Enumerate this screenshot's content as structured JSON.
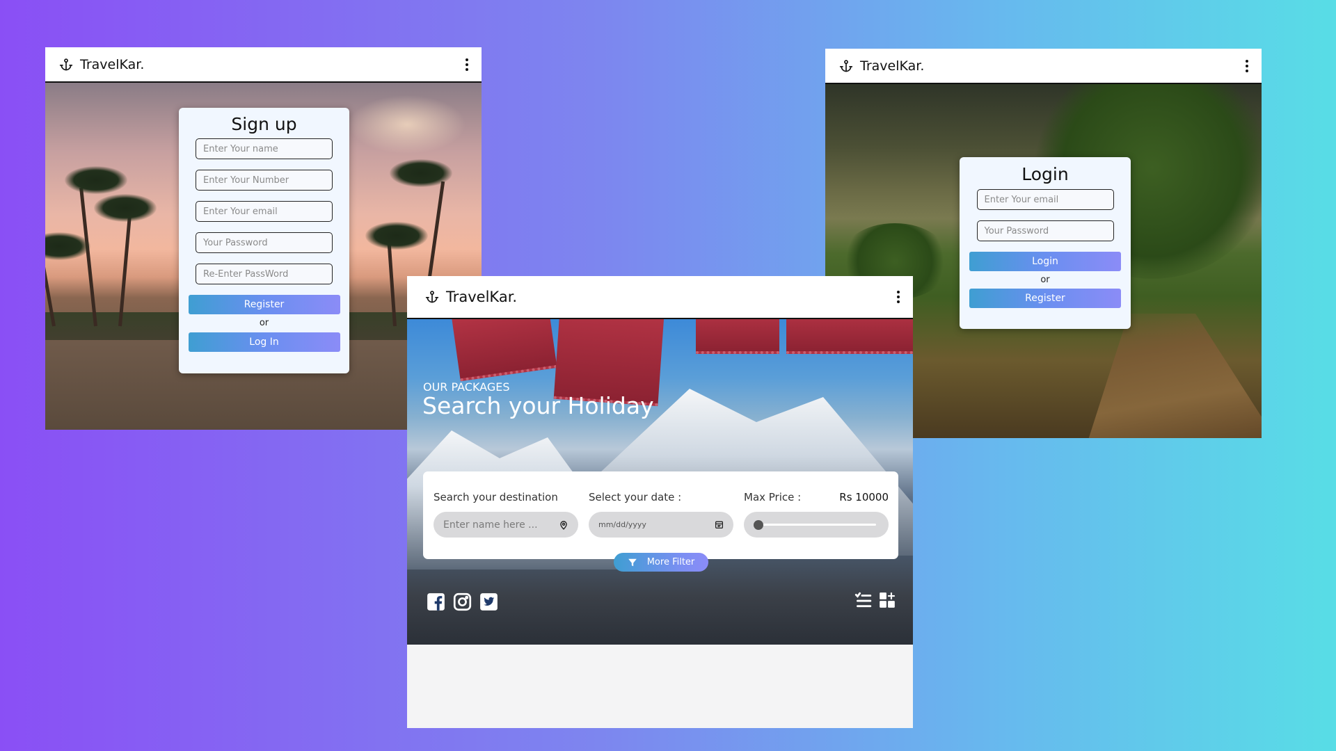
{
  "brand": {
    "name": "TravelKar."
  },
  "signup": {
    "title": "Sign up",
    "name_placeholder": "Enter Your name",
    "number_placeholder": "Enter Your Number",
    "email_placeholder": "Enter Your email",
    "password_placeholder": "Your Password",
    "reenter_placeholder": "Re-Enter PassWord",
    "register_label": "Register",
    "or_text": "or",
    "login_label": "Log In"
  },
  "login": {
    "title": "Login",
    "email_placeholder": "Enter Your email",
    "password_placeholder": "Your Password",
    "login_label": "Login",
    "or_text": "or",
    "register_label": "Register"
  },
  "search": {
    "kicker": "OUR PACKAGES",
    "title": "Search your Holiday",
    "destination_label": "Search your destination",
    "destination_placeholder": "Enter name here ...",
    "date_label": "Select your date :",
    "date_placeholder": "mm/dd/yyyy",
    "price_label": "Max Price :",
    "price_value": "Rs 10000",
    "price_slider_fraction": 0.0,
    "more_filter_label": "More Filter"
  },
  "icons": {
    "brand": "anchor-icon",
    "menu": "kebab-menu-icon",
    "location": "location-pin-icon",
    "calendar": "calendar-icon",
    "filter": "filter-icon",
    "social": [
      "facebook-icon",
      "instagram-icon",
      "twitter-icon"
    ],
    "views": [
      "list-view-icon",
      "grid-view-icon"
    ]
  },
  "colors": {
    "accent_gradient_start": "#3f9ed2",
    "accent_gradient_end": "#8b8cf7",
    "background_start": "#8a4ff5",
    "background_end": "#58dde6"
  }
}
